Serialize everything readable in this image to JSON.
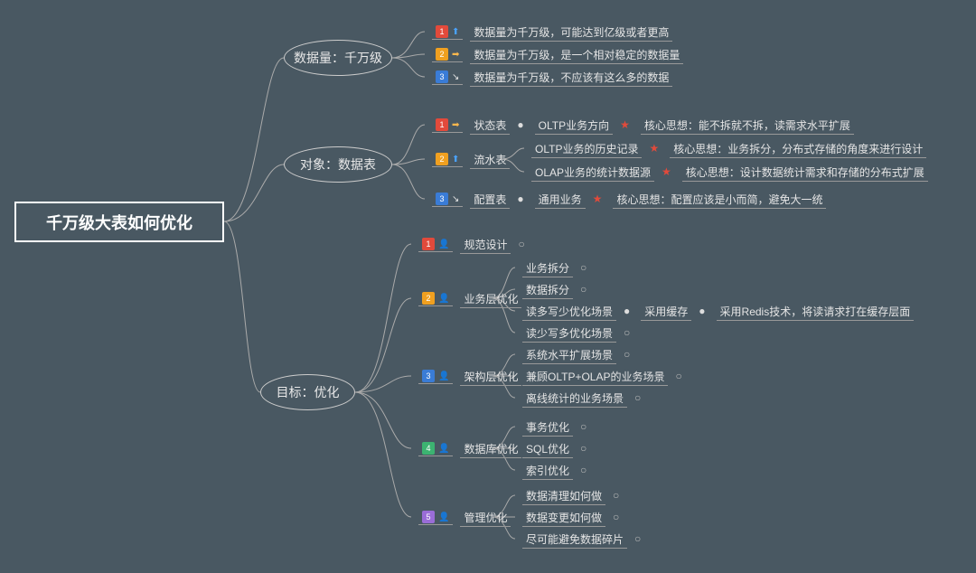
{
  "root": "千万级大表如何优化",
  "nodes": {
    "b1": "数据量：千万级",
    "b2": "对象：数据表",
    "b3": "目标：优化"
  },
  "b1": {
    "r1": "数据量为千万级，可能达到亿级或者更高",
    "r2": "数据量为千万级，是一个相对稳定的数据量",
    "r3": "数据量为千万级，不应该有这么多的数据"
  },
  "b2": {
    "r1_a": "状态表",
    "r1_b": "OLTP业务方向",
    "r1_c": "核心思想：能不拆就不拆，读需求水平扩展",
    "r2_a": "流水表",
    "r2_b1": "OLTP业务的历史记录",
    "r2_c1": "核心思想：业务拆分，分布式存储的角度来进行设计",
    "r2_b2": "OLAP业务的统计数据源",
    "r2_c2": "核心思想：设计数据统计需求和存储的分布式扩展",
    "r3_a": "配置表",
    "r3_b": "通用业务",
    "r3_c": "核心思想：配置应该是小而简，避免大一统"
  },
  "b3": {
    "n1": "规范设计",
    "n2": "业务层优化",
    "n2_c": [
      "业务拆分",
      "数据拆分",
      "读多写少优化场景",
      "读少写多优化场景"
    ],
    "n2_c3a": "采用缓存",
    "n2_c3b": "采用Redis技术，将读请求打在缓存层面",
    "n3": "架构层优化",
    "n3_c": [
      "系统水平扩展场景",
      "兼顾OLTP+OLAP的业务场景",
      "离线统计的业务场景"
    ],
    "n4": "数据库优化",
    "n4_c": [
      "事务优化",
      "SQL优化",
      "索引优化"
    ],
    "n5": "管理优化",
    "n5_c": [
      "数据清理如何做",
      "数据变更如何做",
      "尽可能避免数据碎片"
    ]
  }
}
